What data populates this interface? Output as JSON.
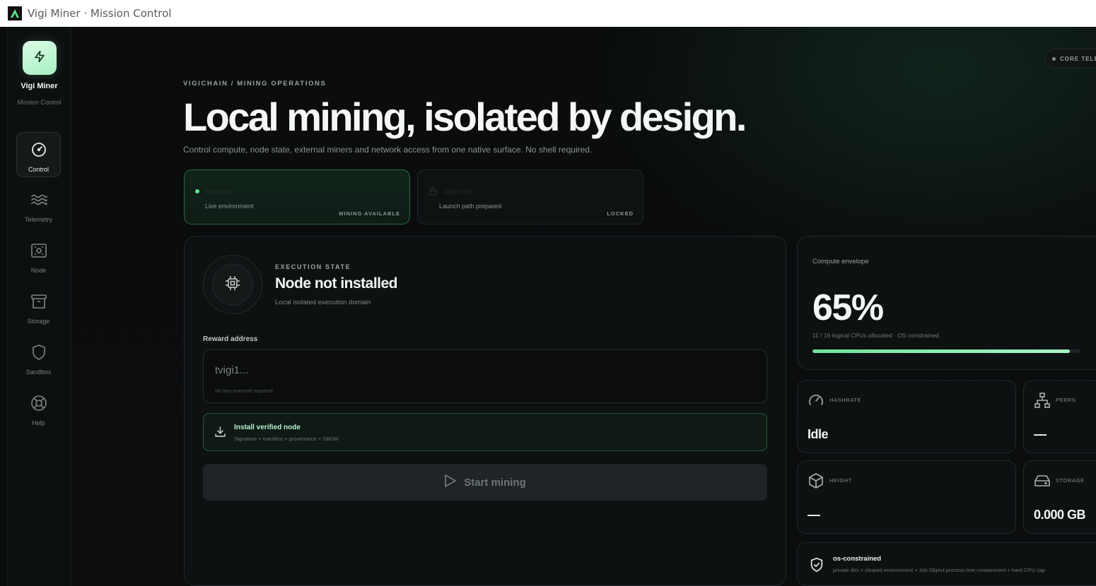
{
  "window": {
    "title": "Vigi Miner · Mission Control"
  },
  "sidebar": {
    "brand_name": "Vigi Miner",
    "brand_sub": "Mission Control",
    "items": [
      {
        "label": "Control",
        "icon": "gauge-icon",
        "active": true
      },
      {
        "label": "Telemetry",
        "icon": "waves-icon",
        "active": false
      },
      {
        "label": "Node",
        "icon": "node-icon",
        "active": false
      },
      {
        "label": "Storage",
        "icon": "archive-icon",
        "active": false
      },
      {
        "label": "Sandbox",
        "icon": "shield-icon",
        "active": false
      },
      {
        "label": "Help",
        "icon": "lifebuoy-icon",
        "active": false
      }
    ]
  },
  "header": {
    "eyebrow": "VIGICHAIN / MINING OPERATIONS",
    "title": "Local mining, isolated by design.",
    "subtitle": "Control compute, node state, external miners and network access from one native surface. No shell required.",
    "telemetry_pill": "CORE TELEM"
  },
  "networks": [
    {
      "name": "Testnet",
      "desc": "Live environment",
      "status": "MINING AVAILABLE",
      "selected": true
    },
    {
      "name": "Mainnet",
      "desc": "Launch path prepared",
      "status": "LOCKED",
      "selected": false
    }
  ],
  "execution": {
    "eyebrow": "EXECUTION STATE",
    "title": "Node not installed",
    "subtitle": "Local isolated execution domain",
    "reward_label": "Reward address",
    "reward_placeholder": "tvigi1...",
    "reward_hint": "No key material required",
    "install_title": "Install verified node",
    "install_sub": "Signature + manifest + provenance + SBOM",
    "start_label": "Start mining"
  },
  "compute": {
    "label": "Compute envelope",
    "value": "65%",
    "sub": "11 / 16 logical CPUs allocated · OS constrained",
    "progress_percent": 96
  },
  "metrics": {
    "hashrate": {
      "label": "HASHRATE",
      "value": "Idle"
    },
    "peers": {
      "label": "PEERS",
      "value": "—"
    },
    "height": {
      "label": "HEIGHT",
      "value": "—"
    },
    "storage": {
      "label": "STORAGE",
      "value": "0.000 GB"
    }
  },
  "sandbox": {
    "title": "os-constrained",
    "sub": "private dirs + cleared environment + Job Object process-tree containment + hard CPU cap"
  },
  "colors": {
    "accent": "#6fe39c",
    "background": "#0b0d0e",
    "card": "#0e1112"
  }
}
